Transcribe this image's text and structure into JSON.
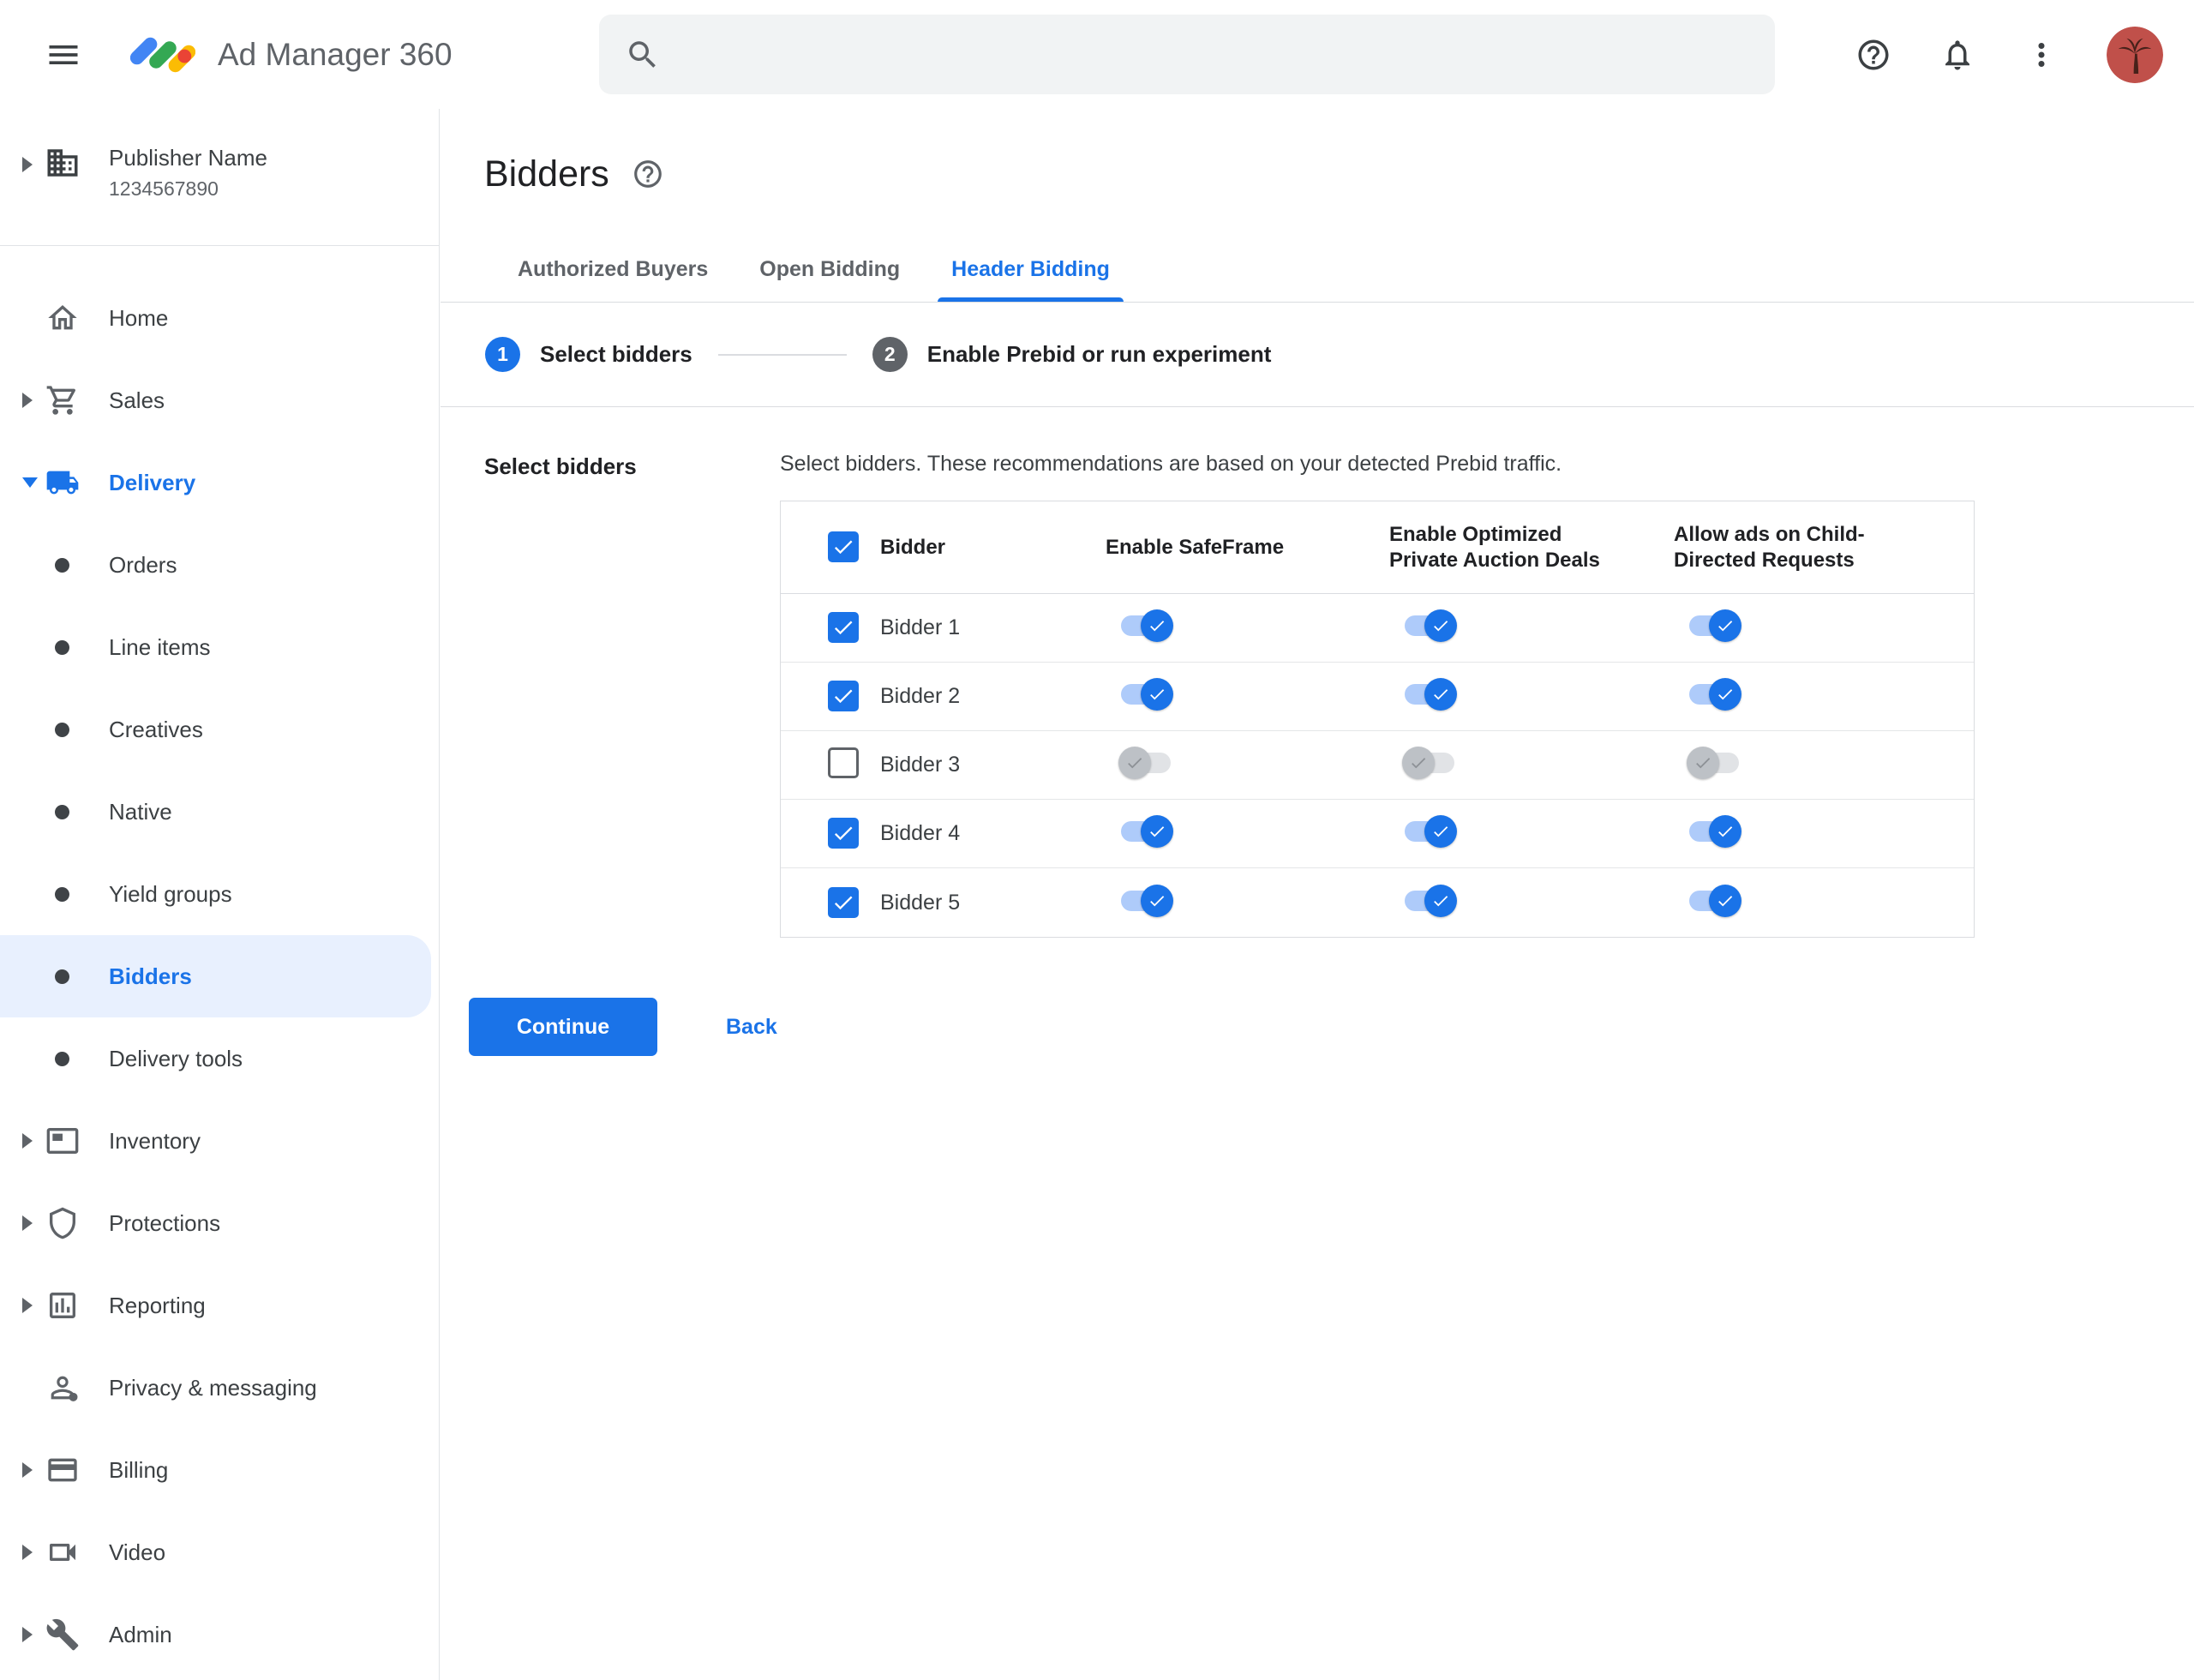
{
  "topbar": {
    "app_name": "Ad Manager 360",
    "search_placeholder": ""
  },
  "publisher": {
    "name": "Publisher Name",
    "id": "1234567890"
  },
  "sidebar": {
    "home": "Home",
    "sales": "Sales",
    "delivery": "Delivery",
    "delivery_children": [
      "Orders",
      "Line items",
      "Creatives",
      "Native",
      "Yield groups",
      "Bidders",
      "Delivery tools"
    ],
    "inventory": "Inventory",
    "protections": "Protections",
    "reporting": "Reporting",
    "privacy_messaging": "Privacy & messaging",
    "billing": "Billing",
    "video": "Video",
    "admin": "Admin"
  },
  "page": {
    "title": "Bidders",
    "tabs": [
      "Authorized Buyers",
      "Open Bidding",
      "Header Bidding"
    ],
    "active_tab": "Header Bidding",
    "steps": [
      {
        "number": "1",
        "label": "Select bidders"
      },
      {
        "number": "2",
        "label": "Enable Prebid or run experiment"
      }
    ],
    "section_label": "Select bidders",
    "description": "Select bidders. These recommendations are based on your detected Prebid traffic.",
    "table": {
      "select_all_checked": true,
      "headers": {
        "bidder": "Bidder",
        "safeframe": "Enable SafeFrame",
        "optimized": "Enable Optimized Private Auction Deals",
        "child_directed": "Allow ads on Child-Directed Requests"
      },
      "rows": [
        {
          "name": "Bidder 1",
          "checked": true,
          "safeframe": true,
          "optimized": true,
          "child_directed": true
        },
        {
          "name": "Bidder 2",
          "checked": true,
          "safeframe": true,
          "optimized": true,
          "child_directed": true
        },
        {
          "name": "Bidder 3",
          "checked": false,
          "safeframe": false,
          "optimized": false,
          "child_directed": false
        },
        {
          "name": "Bidder 4",
          "checked": true,
          "safeframe": true,
          "optimized": true,
          "child_directed": true
        },
        {
          "name": "Bidder 5",
          "checked": true,
          "safeframe": true,
          "optimized": true,
          "child_directed": true
        }
      ]
    },
    "actions": {
      "continue": "Continue",
      "back": "Back"
    }
  },
  "colors": {
    "accent": "#1a73e8",
    "selected_item_bg": "#e8f0fe",
    "toggle_on_track": "#aecbfa",
    "toggle_off_track": "#e1e3e6",
    "toggle_off_thumb": "#bdc1c6",
    "avatar_bg": "#c0504a"
  }
}
